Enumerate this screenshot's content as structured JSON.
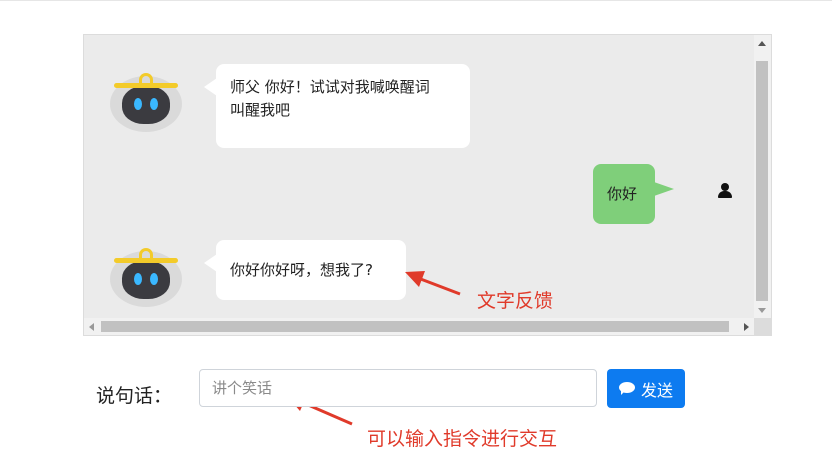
{
  "chat": {
    "messages": [
      {
        "sender": "bot",
        "text_line1": "师父 你好！试试对我喊唤醒词",
        "text_line2": "叫醒我吧"
      },
      {
        "sender": "user",
        "text": "你好"
      },
      {
        "sender": "bot",
        "text": "你好你好呀，想我了?"
      }
    ]
  },
  "annotations": {
    "feedback": "文字反馈",
    "input_hint": "可以输入指令进行交互"
  },
  "input_row": {
    "label": "说句话：",
    "placeholder": "讲个笑话",
    "value": "",
    "send_label": "发送"
  },
  "icons": {
    "bot_avatar": "robot-avatar-icon",
    "user_avatar": "user-icon",
    "send": "comment-icon"
  },
  "colors": {
    "user_bubble": "#7fcf7a",
    "send_button": "#0d7bf0",
    "annotation": "#e03a2a",
    "chat_background": "#ebebeb"
  }
}
